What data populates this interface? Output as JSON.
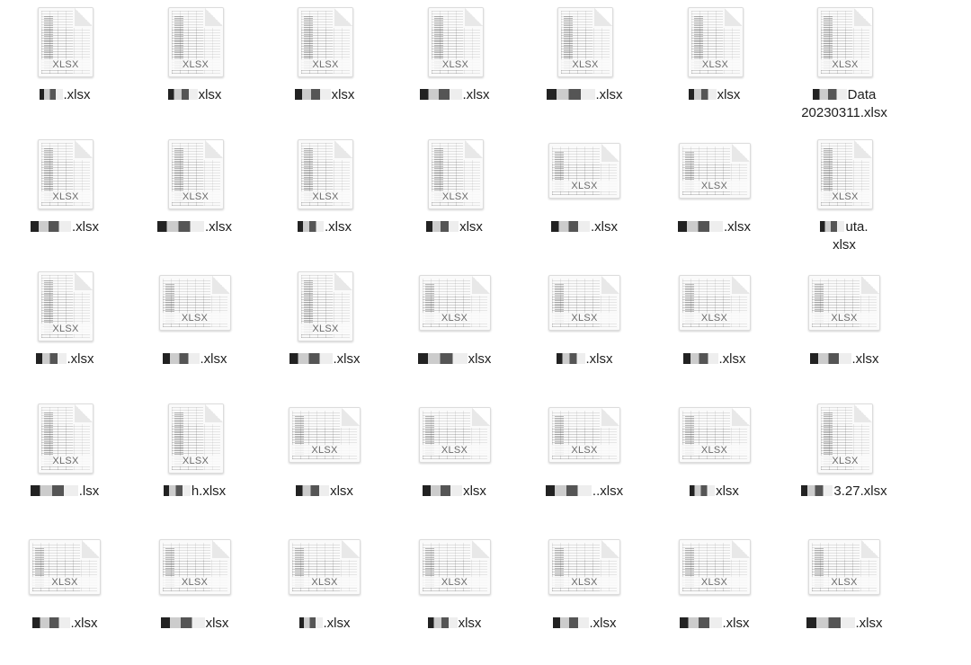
{
  "files": [
    {
      "name": ".xlsx",
      "type": "XLSX",
      "shape": "portrait"
    },
    {
      "name": "xlsx",
      "type": "XLSX",
      "shape": "portrait"
    },
    {
      "name": "xlsx",
      "type": "XLSX",
      "shape": "portrait"
    },
    {
      "name": ".xlsx",
      "type": "XLSX",
      "shape": "portrait"
    },
    {
      "name": ".xlsx",
      "type": "XLSX",
      "shape": "portrait"
    },
    {
      "name": "xlsx",
      "type": "XLSX",
      "shape": "portrait"
    },
    {
      "name": "Data\n20230311.xlsx",
      "type": "XLSX",
      "shape": "portrait"
    },
    {
      "name": ".xlsx",
      "type": "XLSX",
      "shape": "portrait"
    },
    {
      "name": ".xlsx",
      "type": "XLSX",
      "shape": "portrait"
    },
    {
      "name": ".xlsx",
      "type": "XLSX",
      "shape": "portrait"
    },
    {
      "name": "xlsx",
      "type": "XLSX",
      "shape": "portrait"
    },
    {
      "name": ".xlsx",
      "type": "XLSX",
      "shape": "landscape"
    },
    {
      "name": ".xlsx",
      "type": "XLSX",
      "shape": "landscape"
    },
    {
      "name": "uta.\nxlsx",
      "type": "XLSX",
      "shape": "portrait"
    },
    {
      "name": ".xlsx",
      "type": "XLSX",
      "shape": "portrait"
    },
    {
      "name": ".xlsx",
      "type": "XLSX",
      "shape": "landscape"
    },
    {
      "name": ".xlsx",
      "type": "XLSX",
      "shape": "portrait"
    },
    {
      "name": "xlsx",
      "type": "XLSX",
      "shape": "landscape"
    },
    {
      "name": ".xlsx",
      "type": "XLSX",
      "shape": "landscape"
    },
    {
      "name": ".xlsx",
      "type": "XLSX",
      "shape": "landscape"
    },
    {
      "name": ".xlsx",
      "type": "XLSX",
      "shape": "landscape"
    },
    {
      "name": ".lsx",
      "type": "XLSX",
      "shape": "portrait"
    },
    {
      "name": "h.xlsx",
      "type": "XLSX",
      "shape": "portrait"
    },
    {
      "name": "xlsx",
      "type": "XLSX",
      "shape": "landscape"
    },
    {
      "name": "xlsx",
      "type": "XLSX",
      "shape": "landscape"
    },
    {
      "name": "..xlsx",
      "type": "XLSX",
      "shape": "landscape"
    },
    {
      "name": "xlsx",
      "type": "XLSX",
      "shape": "landscape"
    },
    {
      "name": "3.27.xlsx",
      "type": "XLSX",
      "shape": "portrait"
    },
    {
      "name": ".xlsx",
      "type": "XLSX",
      "shape": "landscape"
    },
    {
      "name": "xlsx",
      "type": "XLSX",
      "shape": "landscape"
    },
    {
      "name": ".xlsx",
      "type": "XLSX",
      "shape": "landscape"
    },
    {
      "name": "xlsx",
      "type": "XLSX",
      "shape": "landscape"
    },
    {
      "name": ".xlsx",
      "type": "XLSX",
      "shape": "landscape"
    },
    {
      "name": ".xlsx",
      "type": "XLSX",
      "shape": "landscape"
    },
    {
      "name": ".xlsx",
      "type": "XLSX",
      "shape": "landscape"
    }
  ]
}
